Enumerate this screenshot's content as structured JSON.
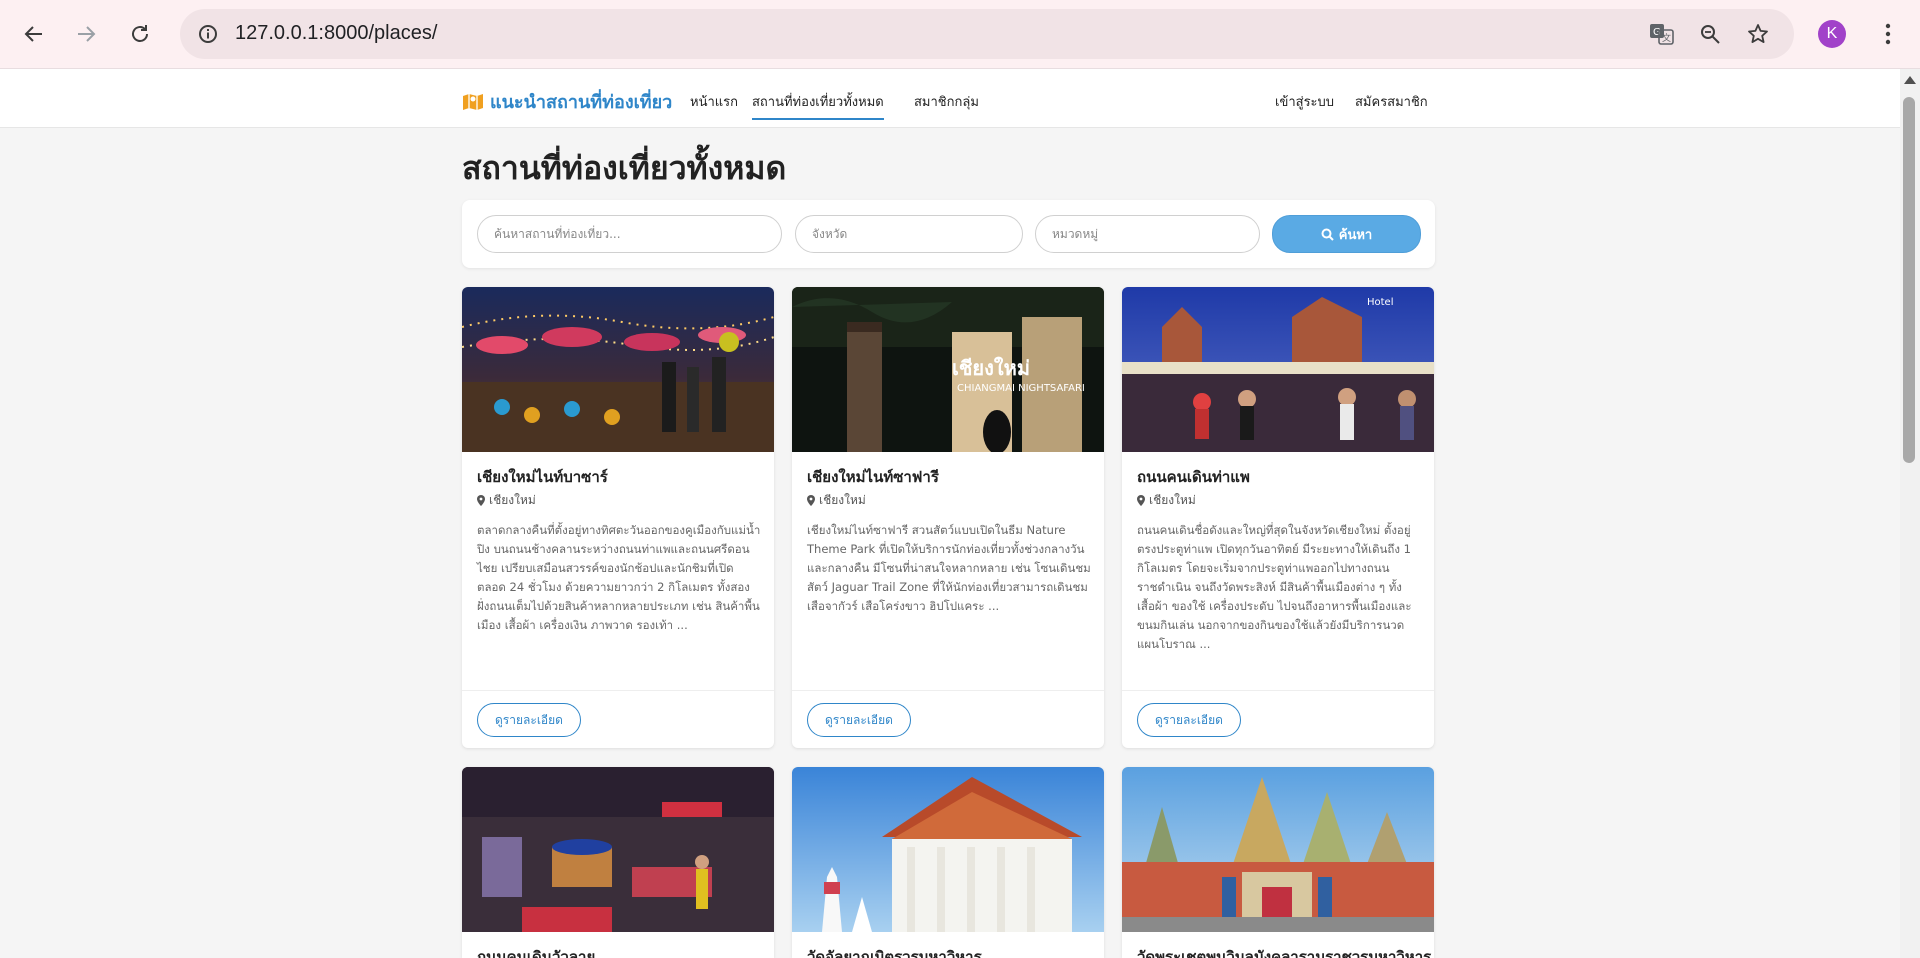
{
  "browser": {
    "url": "127.0.0.1:8000/places/",
    "profile_initial": "K"
  },
  "nav": {
    "brand": "แนะนำสถานที่ท่องเที่ยว",
    "links": [
      "หน้าแรก",
      "สถานที่ท่องเที่ยวทั้งหมด",
      "สมาชิกกลุ่ม"
    ],
    "active_link": "สถานที่ท่องเที่ยวทั้งหมด",
    "login": "เข้าสู่ระบบ",
    "register": "สมัครสมาชิก"
  },
  "page": {
    "title": "สถานที่ท่องเที่ยวทั้งหมด"
  },
  "search": {
    "query_placeholder": "ค้นหาสถานที่ท่องเที่ยว...",
    "province_placeholder": "จังหวัด",
    "category_placeholder": "หมวดหมู่",
    "button": "ค้นหา"
  },
  "cards": [
    {
      "title": "เชียงใหม่ไนท์บาซาร์",
      "location": "เชียงใหม่",
      "description": "ตลาดกลางคืนที่ตั้งอยู่ทางทิศตะวันออกของคูเมืองกับแม่น้ำปิง บนถนนช้างคลานระหว่างถนนท่าแพและถนนศรีดอนไชย เปรียบเสมือนสวรรค์ของนักช้อปและนักชิมที่เปิดตลอด 24 ชั่วโมง ด้วยความยาวกว่า 2 กิโลเมตร ทั้งสองฝั่งถนนเต็มไปด้วยสินค้าหลากหลายประเภท เช่น สินค้าพื้นเมือง เสื้อผ้า เครื่องเงิน ภาพวาด รองเท้า ...",
      "button": "ดูรายละเอียด"
    },
    {
      "title": "เชียงใหม่ไนท์ซาฟารี",
      "location": "เชียงใหม่",
      "description": "เชียงใหม่ไนท์ซาฟารี สวนสัตว์แบบเปิดในธีม Nature Theme Park ที่เปิดให้บริการนักท่องเที่ยวทั้งช่วงกลางวันและกลางคืน มีโซนที่น่าสนใจหลากหลาย เช่น โซนเดินชมสัตว์ Jaguar Trail Zone ที่ให้นักท่องเที่ยวสามารถเดินชมเสือจากัวร์ เสือโคร่งขาว ฮิปโปแคระ ...",
      "button": "ดูรายละเอียด"
    },
    {
      "title": "ถนนคนเดินท่าแพ",
      "location": "เชียงใหม่",
      "description": "ถนนคนเดินชื่อดังและใหญ่ที่สุดในจังหวัดเชียงใหม่ ตั้งอยู่ตรงประตูท่าแพ เปิดทุกวันอาทิตย์ มีระยะทางให้เดินถึง 1 กิโลเมตร โดยจะเริ่มจากประตูท่าแพออกไปทางถนนราชดำเนิน จนถึงวัดพระสิงห์ มีสินค้าพื้นเมืองต่าง ๆ ทั้งเสื้อผ้า ของใช้ เครื่องประดับ ไปจนถึงอาหารพื้นเมืองและขนมกินเล่น นอกจากของกินของใช้แล้วยังมีบริการนวดแผนโบราณ ...",
      "button": "ดูรายละเอียด"
    },
    {
      "title": "ถนนคนเดินวัวลาย"
    },
    {
      "title": "วัดอัลยาณมิตรวรมหาวิหาร"
    },
    {
      "title": "วัดพระเชตุพนวิมลมังคลารามราชวรมหาวิหาร"
    }
  ],
  "icon_colors": {
    "brand": "#f0a020",
    "accent": "#2f86c9"
  }
}
